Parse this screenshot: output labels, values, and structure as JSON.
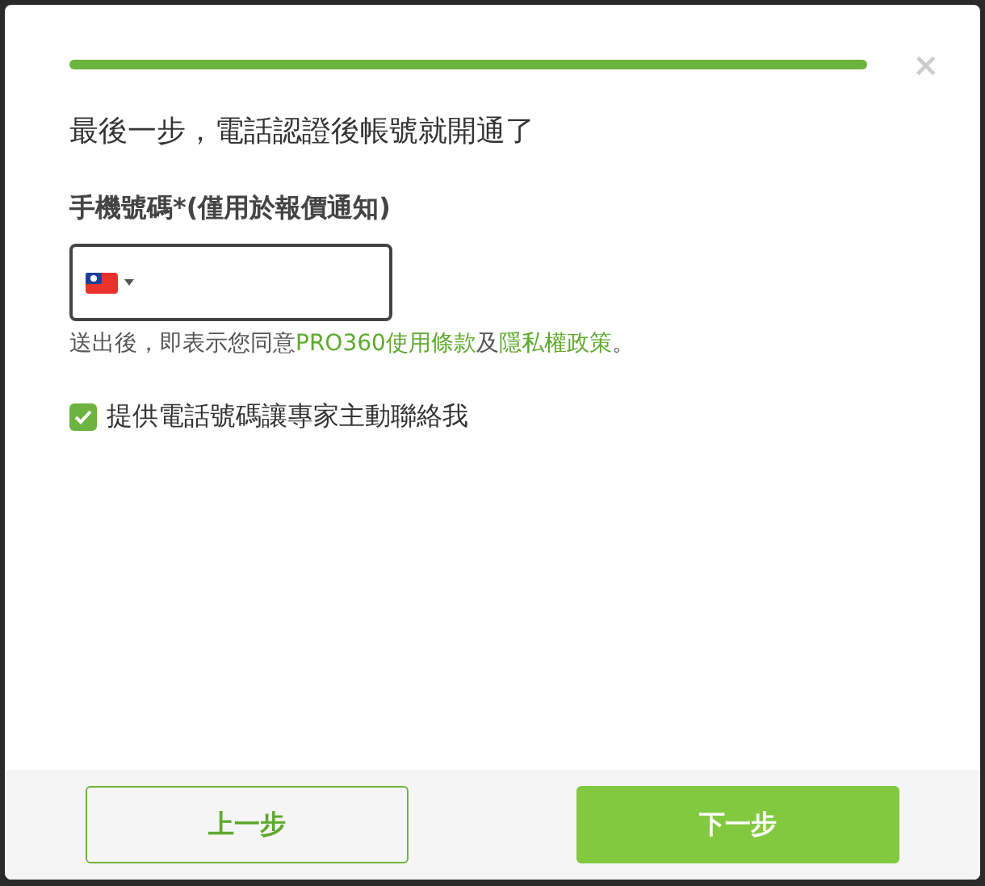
{
  "progress": {
    "level": 1
  },
  "close": "×",
  "title": "最後一步，電話認證後帳號就開通了",
  "phone": {
    "label": "手機號碼*(僅用於報價通知)"
  },
  "consent": {
    "before": "送出後，即表示您同意",
    "link_1": "PRO360使用條款",
    "middle": "及",
    "link_2": "隱私權政策",
    "after": "。"
  },
  "contact_option": {
    "label": "提供電話號碼讓專家主動聯絡我",
    "checked": true
  },
  "buttons": [
    {
      "label": "上一步",
      "kind": "secondary"
    },
    {
      "label": "下一步",
      "kind": "primary"
    }
  ]
}
